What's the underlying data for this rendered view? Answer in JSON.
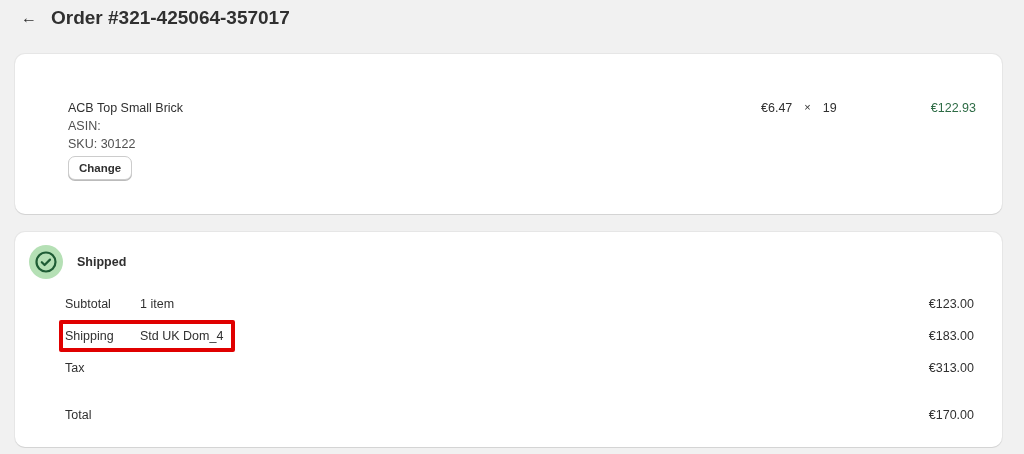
{
  "header": {
    "back": "←",
    "title": "Order #321-425064-357017"
  },
  "line_item": {
    "name": "ACB Top Small Brick",
    "asin": "ASIN:",
    "sku": "SKU: 30122",
    "button": "Change",
    "price": "€6.47",
    "times": "×",
    "quantity": "19",
    "total": "€122.93"
  },
  "fulfillment": {
    "status": "Shipped",
    "shipped": true,
    "rows": [
      {
        "kind": "line",
        "label": "Subtotal",
        "detail": "1 item",
        "amount": "€123.00",
        "highlighted": false
      },
      {
        "kind": "line",
        "label": "Shipping",
        "detail": "Std UK Dom_4",
        "amount": "€183.00",
        "highlighted": true
      },
      {
        "kind": "line",
        "label": "Tax",
        "amount": "€313.00",
        "highlighted": false
      },
      {
        "kind": "total",
        "label": "Total",
        "amount": "€170.00",
        "highlighted": false
      }
    ]
  }
}
